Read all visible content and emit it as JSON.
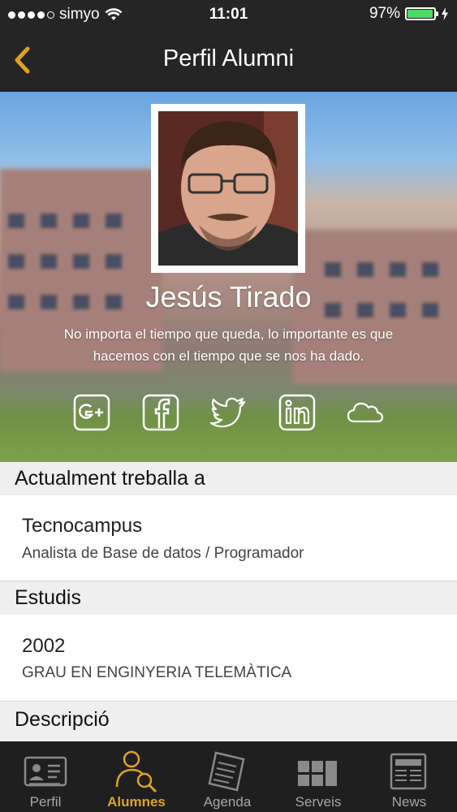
{
  "status": {
    "carrier": "simyo",
    "time": "11:01",
    "battery": "97%",
    "battery_level": 0.97
  },
  "navbar": {
    "title": "Perfil Alumni",
    "back_icon": "chevron-left-icon",
    "accent": "#e0a21e"
  },
  "profile": {
    "name": "Jesús Tirado",
    "quote_line1": "No importa el tiempo que queda, lo importante es que",
    "quote_line2": "hacemos con el tiempo que se nos ha dado.",
    "social_icons": [
      "google-plus-icon",
      "facebook-icon",
      "twitter-icon",
      "linkedin-icon",
      "cloud-icon"
    ]
  },
  "work": {
    "header": "Actualment treballa a",
    "company": "Tecnocampus",
    "role": "Analista de Base de datos / Programador"
  },
  "studies": {
    "header": "Estudis",
    "year": "2002",
    "degree": "GRAU EN ENGINYERIA TELEMÀTICA"
  },
  "description": {
    "header": "Descripció"
  },
  "tabs": [
    {
      "label": "Perfil",
      "icon": "id-card-icon",
      "active": false
    },
    {
      "label": "Alumnes",
      "icon": "people-search-icon",
      "active": true
    },
    {
      "label": "Agenda",
      "icon": "notepad-icon",
      "active": false
    },
    {
      "label": "Serveis",
      "icon": "blocks-icon",
      "active": false
    },
    {
      "label": "News",
      "icon": "newspaper-icon",
      "active": false
    }
  ]
}
